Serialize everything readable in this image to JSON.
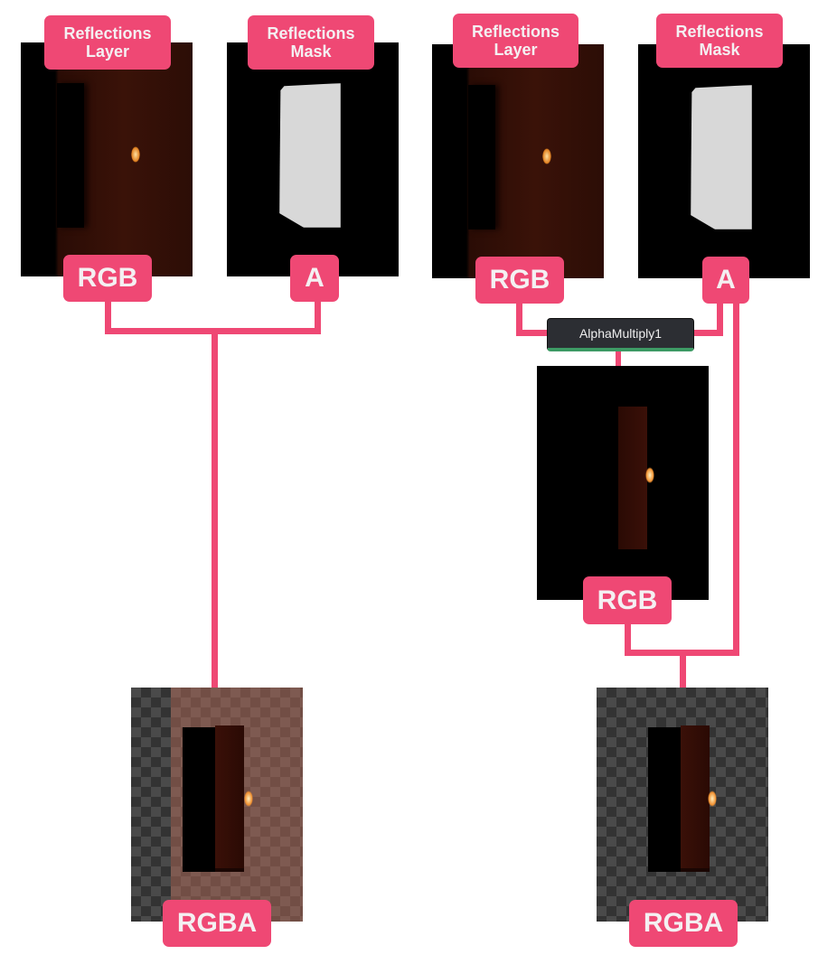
{
  "left": {
    "layer_label": "Reflections Layer",
    "mask_label": "Reflections Mask",
    "rgb_label": "RGB",
    "a_label": "A",
    "output_label": "RGBA"
  },
  "right": {
    "layer_label": "Reflections Layer",
    "mask_label": "Reflections Mask",
    "rgb_label": "RGB",
    "a_label": "A",
    "node_label": "AlphaMultiply1",
    "mid_rgb_label": "RGB",
    "output_label": "RGBA"
  },
  "colors": {
    "accent": "#ef4874",
    "node_bg": "#2c2e33",
    "node_status": "#3c9a64"
  }
}
